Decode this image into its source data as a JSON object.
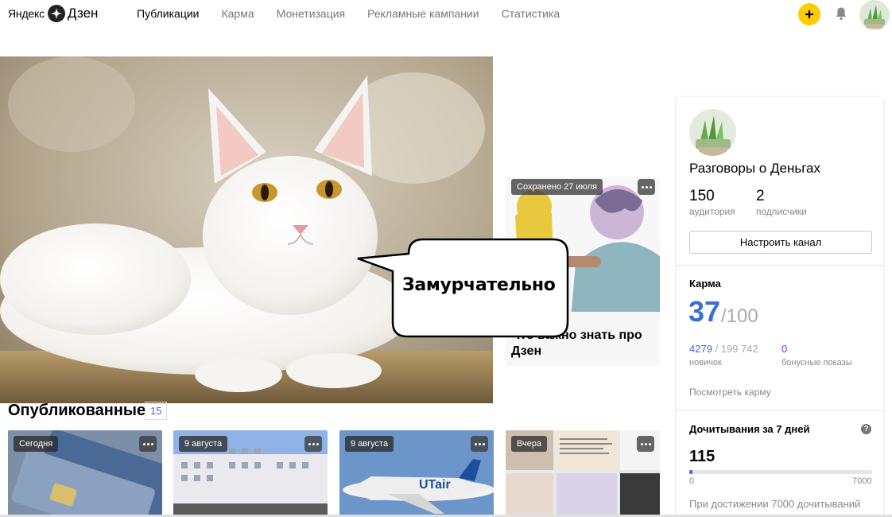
{
  "header": {
    "logo_left": "Яндекс",
    "logo_right": "Дзен",
    "nav": [
      {
        "label": "Публикации",
        "active": true
      },
      {
        "label": "Карма",
        "active": false
      },
      {
        "label": "Монетизация",
        "active": false
      },
      {
        "label": "Рекламные кампании",
        "active": false
      },
      {
        "label": "Статистика",
        "active": false
      }
    ],
    "icons": {
      "add": "plus-icon",
      "notifications": "bell-icon",
      "avatar": "user-avatar"
    }
  },
  "hero": {
    "speech_bubble": "Замурчательно"
  },
  "article_card": {
    "badge": "Сохранено 27 июля",
    "title": "Что важно знать про Дзен"
  },
  "published": {
    "title": "Опубликованные",
    "count": "15",
    "items": [
      {
        "badge": "Сегодня"
      },
      {
        "badge": "9 августа"
      },
      {
        "badge": "9 августа"
      },
      {
        "badge": "Вчера"
      }
    ]
  },
  "sidebar": {
    "channel_name": "Разговоры о Деньгах",
    "audience_value": "150",
    "audience_label": "аудитория",
    "subscribers_value": "2",
    "subscribers_label": "подписчики",
    "setup_button": "Настроить канал",
    "karma": {
      "title": "Карма",
      "value": "37",
      "max": "/100",
      "score": "4279",
      "score_max": "/ 199 742",
      "level": "новичок",
      "bonus_value": "0",
      "bonus_label": "бонусные показы",
      "link": "Посмотреть карму"
    },
    "reads": {
      "title": "Дочитывания за 7 дней",
      "value": "115",
      "scale_min": "0",
      "scale_max": "7000",
      "progress_fraction": 0.0164,
      "note": "При достижении 7000 дочитываний"
    }
  },
  "colors": {
    "accent": "#3b6fd1",
    "add_button": "#ffcc00",
    "bonus": "#8e2de2"
  }
}
